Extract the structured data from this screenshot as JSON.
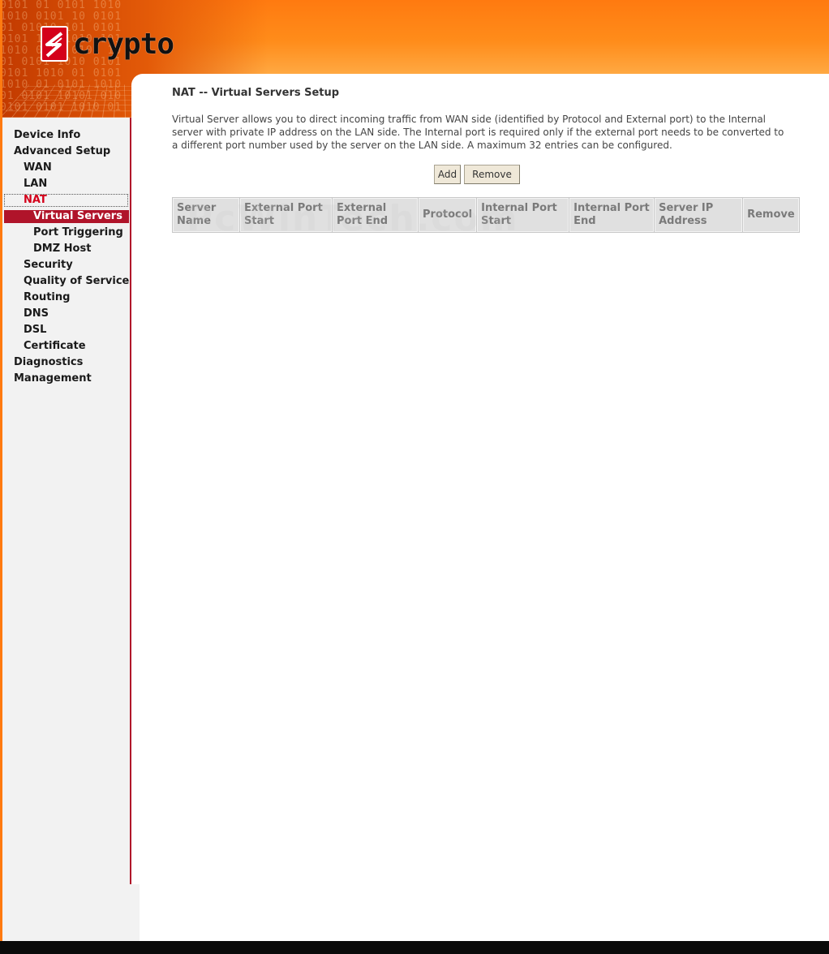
{
  "brand": {
    "logo_text": "crypto"
  },
  "sidebar": {
    "items": [
      {
        "label": "Device Info"
      },
      {
        "label": "Advanced Setup"
      },
      {
        "label": "WAN"
      },
      {
        "label": "LAN"
      },
      {
        "label": "NAT"
      },
      {
        "label": "Virtual Servers"
      },
      {
        "label": "Port Triggering"
      },
      {
        "label": "DMZ Host"
      },
      {
        "label": "Security"
      },
      {
        "label": "Quality of Service"
      },
      {
        "label": "Routing"
      },
      {
        "label": "DNS"
      },
      {
        "label": "DSL"
      },
      {
        "label": "Certificate"
      },
      {
        "label": "Diagnostics"
      },
      {
        "label": "Management"
      }
    ],
    "selected": "Virtual Servers",
    "active_parent": "NAT"
  },
  "main": {
    "title": "NAT -- Virtual Servers Setup",
    "description": "Virtual Server allows you to direct incoming traffic from WAN side (identified by Protocol and External port) to the Internal server with private IP address on the LAN side. The Internal port is required only if the external port needs to be converted to a different port number used by the server on the LAN side. A maximum 32 entries can be configured.",
    "buttons": {
      "add": "Add",
      "remove": "Remove"
    },
    "table": {
      "headers": [
        "Server Name",
        "External Port Start",
        "External Port End",
        "Protocol",
        "Internal Port Start",
        "Internal Port End",
        "Server IP Address",
        "Remove"
      ],
      "rows": []
    },
    "watermark": "PcWinTech.com"
  },
  "colors": {
    "accent": "#b0142a",
    "header_orange": "#ff7a10",
    "active_nav": "#d4001a"
  }
}
